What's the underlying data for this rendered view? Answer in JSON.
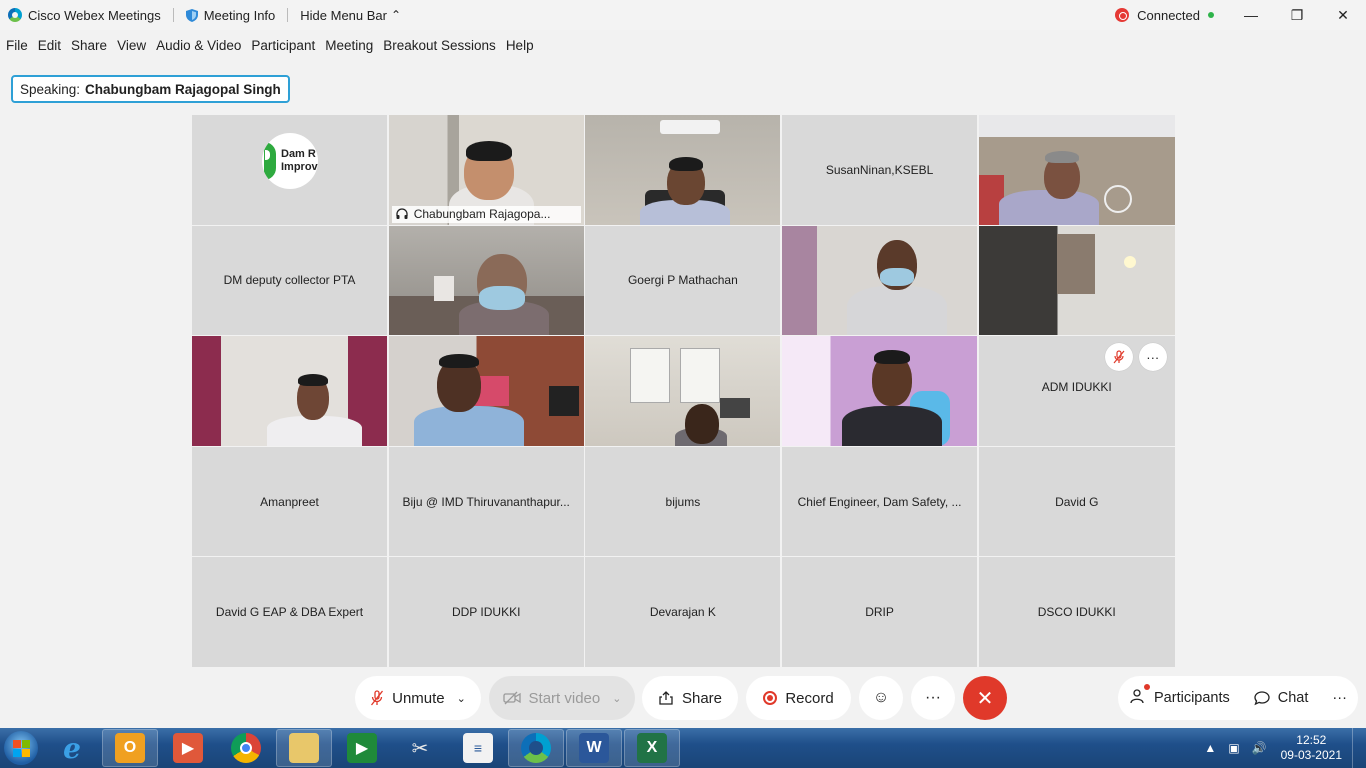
{
  "titlebar": {
    "app_name": "Cisco Webex Meetings",
    "meeting_info": "Meeting Info",
    "hide_menu": "Hide Menu Bar",
    "status": "Connected",
    "minimize": "—",
    "restore": "❐",
    "close": "✕"
  },
  "menu": [
    "File",
    "Edit",
    "Share",
    "View",
    "Audio & Video",
    "Participant",
    "Meeting",
    "Breakout Sessions",
    "Help"
  ],
  "speaking": {
    "label": "Speaking:",
    "name": "Chabungbam Rajagopal Singh"
  },
  "tiles": [
    {
      "name": "",
      "logo_line1": "Dam R",
      "logo_line2": "Improv"
    },
    {
      "name": "Chabungbam Rajagopa..."
    },
    {
      "name": ""
    },
    {
      "name": "SusanNinan,KSEBL"
    },
    {
      "name": ""
    },
    {
      "name": "DM deputy collector PTA"
    },
    {
      "name": ""
    },
    {
      "name": "Goergi P Mathachan"
    },
    {
      "name": ""
    },
    {
      "name": ""
    },
    {
      "name": ""
    },
    {
      "name": ""
    },
    {
      "name": ""
    },
    {
      "name": ""
    },
    {
      "name": "ADM IDUKKI"
    },
    {
      "name": "Amanpreet"
    },
    {
      "name": "Biju @ IMD Thiruvananthapur..."
    },
    {
      "name": "bijums"
    },
    {
      "name": "Chief Engineer, Dam Safety, ..."
    },
    {
      "name": "David G"
    },
    {
      "name": "David G EAP & DBA Expert"
    },
    {
      "name": "DDP IDUKKI"
    },
    {
      "name": "Devarajan K"
    },
    {
      "name": "DRIP"
    },
    {
      "name": "DSCO IDUKKI"
    }
  ],
  "controls": {
    "unmute": "Unmute",
    "start_video": "Start video",
    "share": "Share",
    "record": "Record",
    "participants": "Participants",
    "chat": "Chat"
  },
  "clock": {
    "time": "12:52",
    "date": "09-03-2021"
  },
  "colors": {
    "accent": "#25b5e6",
    "end_call": "#e0392a",
    "connected": "#2eb34a"
  }
}
